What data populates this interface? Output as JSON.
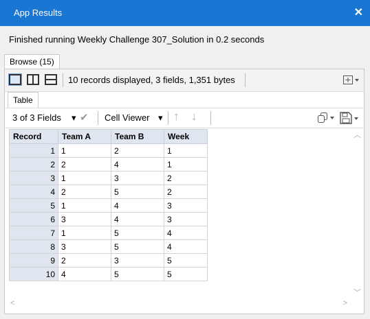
{
  "window": {
    "title": "App Results",
    "close_glyph": "✕"
  },
  "status_message": "Finished running Weekly Challenge 307_Solution in 0.2 seconds",
  "browse_tab": {
    "label": "Browse (15)"
  },
  "toolbar": {
    "records_info": "10 records displayed, 3 fields, 1,351 bytes",
    "layout_icons": [
      "single-view-icon",
      "side-by-side-view-icon",
      "stacked-view-icon"
    ]
  },
  "table_tab": {
    "label": "Table"
  },
  "subtoolbar": {
    "fields_selector": "3 of 3 Fields",
    "cell_viewer": "Cell Viewer",
    "dropdown_glyph": "▾",
    "check_glyph": "✔",
    "up_glyph": "↑",
    "down_glyph": "↓"
  },
  "grid": {
    "columns": [
      "Record",
      "Team A",
      "Team B",
      "Week"
    ],
    "rows": [
      {
        "record": "1",
        "team_a": "1",
        "team_b": "2",
        "week": "1"
      },
      {
        "record": "2",
        "team_a": "2",
        "team_b": "4",
        "week": "1"
      },
      {
        "record": "3",
        "team_a": "1",
        "team_b": "3",
        "week": "2"
      },
      {
        "record": "4",
        "team_a": "2",
        "team_b": "5",
        "week": "2"
      },
      {
        "record": "5",
        "team_a": "1",
        "team_b": "4",
        "week": "3"
      },
      {
        "record": "6",
        "team_a": "3",
        "team_b": "4",
        "week": "3"
      },
      {
        "record": "7",
        "team_a": "1",
        "team_b": "5",
        "week": "4"
      },
      {
        "record": "8",
        "team_a": "3",
        "team_b": "5",
        "week": "4"
      },
      {
        "record": "9",
        "team_a": "2",
        "team_b": "3",
        "week": "5"
      },
      {
        "record": "10",
        "team_a": "4",
        "team_b": "5",
        "week": "5"
      }
    ]
  },
  "colors": {
    "titlebar": "#1976d2",
    "header_bg": "#dfe6ef"
  }
}
